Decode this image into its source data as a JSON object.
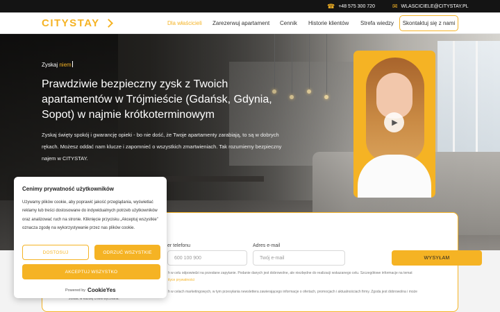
{
  "topbar": {
    "phone": "+48 575 300 720",
    "email": "WLASCICIELE@CITYSTAY.PL",
    "phone_icon": "phone-icon",
    "email_icon": "mail-icon"
  },
  "header": {
    "logo": "CITYSTAY",
    "nav": [
      "Dla właścicieli",
      "Zarezerwuj apartament",
      "Cennik",
      "Historie klientów",
      "Strefa wiedzy"
    ],
    "active_nav": "Dla właścicieli",
    "cta": "Skontaktuj się z nami"
  },
  "hero": {
    "eyebrow_prefix": "Zyskaj ",
    "eyebrow_highlight": "niem",
    "headline": "Prawdziwie bezpieczny zysk z Twoich apartamentów w Trójmieście (Gdańsk, Gdynia, Sopot) w najmie krótkoterminowym",
    "lede": "Zyskaj święty spokój i gwarancję opieki - bo nie dość, że Twoje apartamenty zarabiają, to są w dobrych rękach. Możesz oddać nam klucze i zapomnieć o wszystkich zmartwieniach. Tak rozumiemy bezpieczny najem w CITYSTAY.",
    "video_icon": "play-icon"
  },
  "form": {
    "phone_label": "er telefonu",
    "phone_placeholder": "600 100 900",
    "email_label": "Adres e-mail",
    "email_placeholder": "Twój e-mail",
    "submit": "WYSYŁAM",
    "consent1_line1": "h w celu odpowiedzi na przesłane zapytanie. Podanie danych jest dobrowolne, ale niezbędne do realizacji wskazanego celu. Szczegółowe informacje na temat",
    "consent1_link": "ityce prywatności",
    "consent2_line1": "h w celach marketingowych, w tym przesyłania newslettera zawierającego informacje o ofertach, promocjach i aktualnościach firmy. Zgoda jest dobrowolna i może",
    "consent2_line2": "zostac w każdej chwili wycofana."
  },
  "cookie": {
    "title": "Cenimy prywatność użytkowników",
    "body": "Używamy plików cookie, aby poprawić jakość przeglądania, wyświetlać reklamy lub treści dostosowane do indywidualnych potrzeb użytkowników oraz analizować ruch na stronie. Kliknięcie przycisku „Akceptuj wszystkie” oznacza zgodę na wykorzystywanie przez nas plików cookie.",
    "customize": "DOSTOSUJ",
    "reject": "ODRZUĆ WSZYSTKIE",
    "accept": "AKCEPTUJ WSZYSTKO",
    "powered_prefix": "Powered by",
    "powered_brand": "CookieYes"
  },
  "colors": {
    "accent": "#f5b324",
    "topbar": "#141414"
  }
}
